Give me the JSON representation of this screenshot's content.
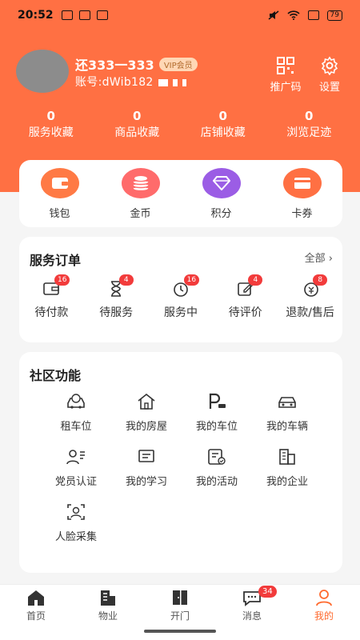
{
  "status_bar": {
    "time": "20:52",
    "battery": "79"
  },
  "profile": {
    "name": "还333一333",
    "badge": "VIP会员",
    "account_prefix": "账号:dWib182"
  },
  "header_actions": [
    {
      "label": "推广码",
      "icon": "qr-code-icon"
    },
    {
      "label": "设置",
      "icon": "gear-icon"
    }
  ],
  "stats": [
    {
      "value": "0",
      "label": "服务收藏"
    },
    {
      "value": "0",
      "label": "商品收藏"
    },
    {
      "value": "0",
      "label": "店铺收藏"
    },
    {
      "value": "0",
      "label": "浏览足迹"
    }
  ],
  "wallet": [
    {
      "label": "钱包",
      "icon": "wallet-icon",
      "color": "#ff7a45"
    },
    {
      "label": "金币",
      "icon": "coins-icon",
      "color": "#ff6b6b"
    },
    {
      "label": "积分",
      "icon": "diamond-icon",
      "color": "#9b5de5"
    },
    {
      "label": "卡券",
      "icon": "card-icon",
      "color": "#ff7043"
    }
  ],
  "orders": {
    "title": "服务订单",
    "all_link": "全部",
    "items": [
      {
        "label": "待付款",
        "badge": "16",
        "icon": "wallet-outline-icon"
      },
      {
        "label": "待服务",
        "badge": "4",
        "icon": "hourglass-icon"
      },
      {
        "label": "服务中",
        "badge": "16",
        "icon": "clock-icon"
      },
      {
        "label": "待评价",
        "badge": "4",
        "icon": "edit-icon"
      },
      {
        "label": "退款/售后",
        "badge": "8",
        "icon": "refund-icon"
      }
    ]
  },
  "community": {
    "title": "社区功能",
    "items": [
      {
        "label": "租车位",
        "icon": "rent-car-icon"
      },
      {
        "label": "我的房屋",
        "icon": "house-icon"
      },
      {
        "label": "我的车位",
        "icon": "parking-icon"
      },
      {
        "label": "我的车辆",
        "icon": "car-icon"
      },
      {
        "label": "党员认证",
        "icon": "member-id-icon"
      },
      {
        "label": "我的学习",
        "icon": "study-icon"
      },
      {
        "label": "我的活动",
        "icon": "activity-icon"
      },
      {
        "label": "我的企业",
        "icon": "building-icon"
      },
      {
        "label": "人脸采集",
        "icon": "face-scan-icon"
      }
    ]
  },
  "tabbar": [
    {
      "label": "首页",
      "icon": "home-icon"
    },
    {
      "label": "物业",
      "icon": "property-icon"
    },
    {
      "label": "开门",
      "icon": "door-icon"
    },
    {
      "label": "消息",
      "icon": "message-icon",
      "badge": "34"
    },
    {
      "label": "我的",
      "icon": "user-icon",
      "active": true
    }
  ]
}
